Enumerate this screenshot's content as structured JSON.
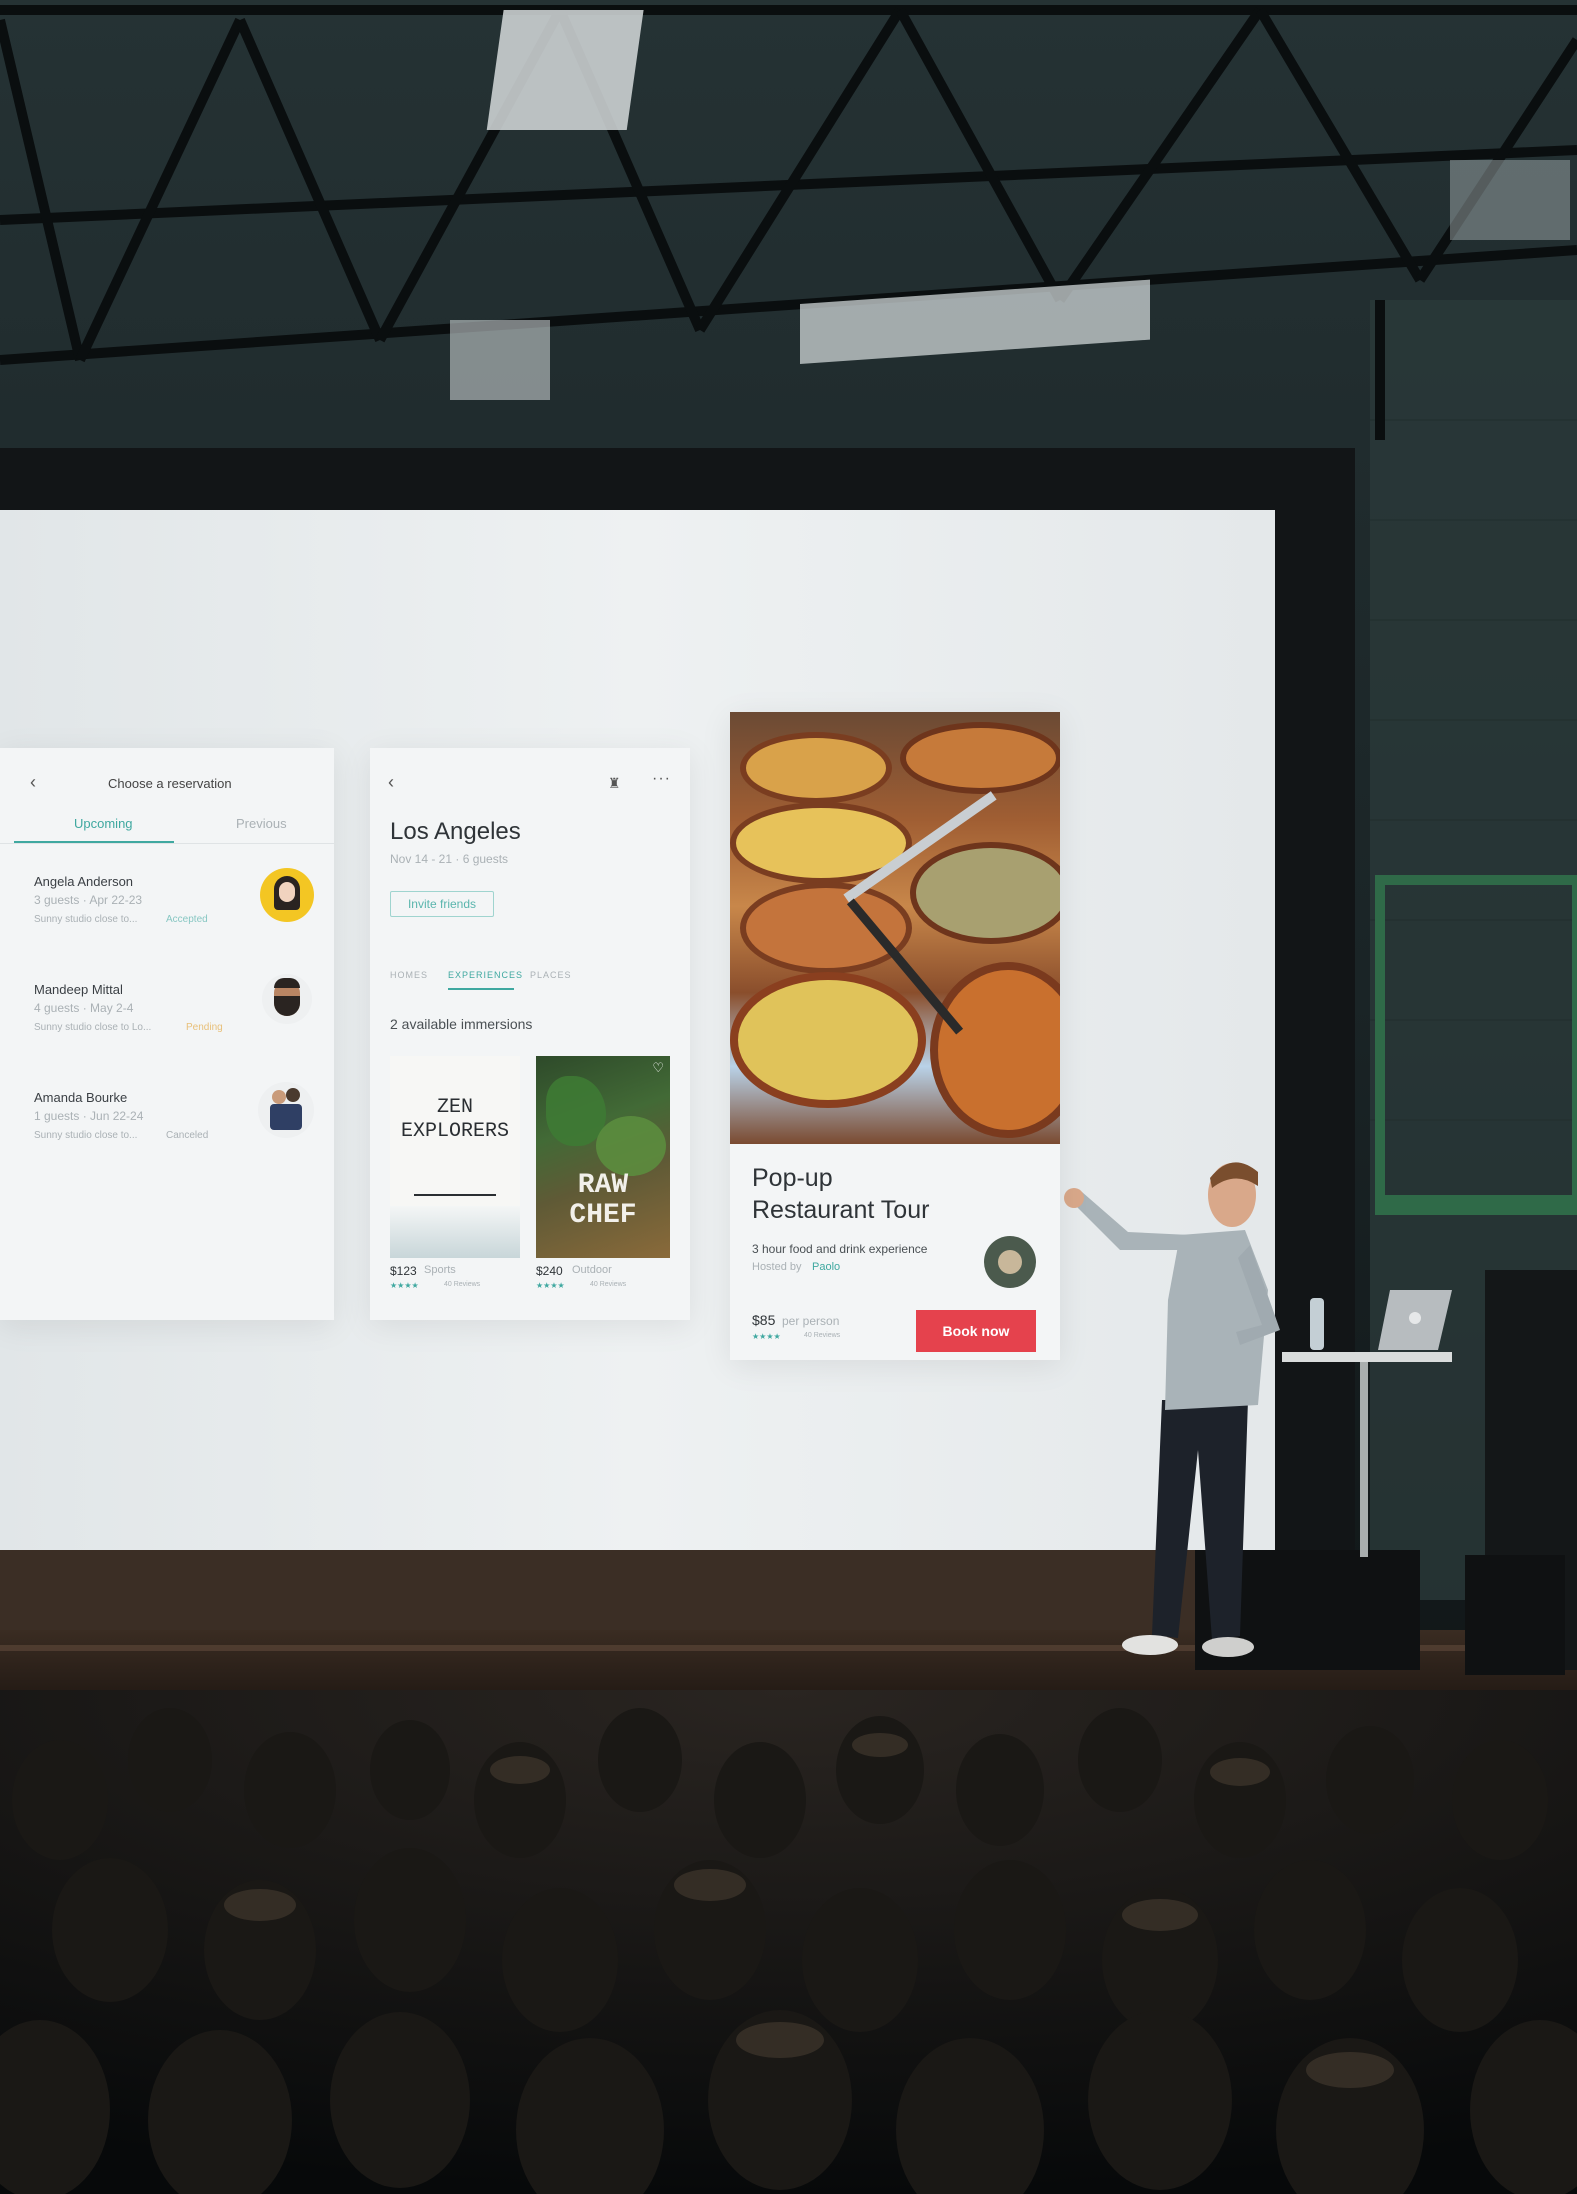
{
  "screen": {
    "left_panel": {
      "back_icon": "chevron-left-icon",
      "title": "Choose a reservation",
      "tabs": [
        "Upcoming",
        "Previous"
      ],
      "items": [
        {
          "name": "Angela Anderson",
          "details": "3 guests · Apr 22-23",
          "desc": "Sunny studio close to...",
          "status": "Accepted"
        },
        {
          "name": "Mandeep Mittal",
          "details": "4 guests · May 2-4",
          "desc": "Sunny studio close to Lo...",
          "status": "Pending"
        },
        {
          "name": "Amanda Bourke",
          "details": "1 guests · Jun 22-24",
          "desc": "Sunny studio close to...",
          "status": "Canceled"
        }
      ]
    },
    "middle_panel": {
      "back_icon": "chevron-left-icon",
      "gift_icon": "gift-icon",
      "more_icon": "more-icon",
      "city": "Los Angeles",
      "dates": "Nov 14 - 21 · 6 guests",
      "invite_label": "Invite friends",
      "tabs": [
        "HOMES",
        "EXPERIENCES",
        "PLACES"
      ],
      "section_title": "2 available immersions",
      "cards": [
        {
          "cover": "ZEN EXPLORERS",
          "price": "$123",
          "category": "Sports",
          "reviews": "40 Reviews",
          "rating": 4
        },
        {
          "cover": "RAW CHEF",
          "price": "$240",
          "category": "Outdoor",
          "reviews": "40 Reviews",
          "rating": 4
        }
      ]
    },
    "right_panel": {
      "title_line1": "Pop-up",
      "title_line2": "Restaurant Tour",
      "description": "3 hour food and drink experience",
      "host_prefix": "Hosted by",
      "host_name": "Paolo",
      "price": "$85",
      "price_suffix": "per person",
      "reviews": "40 Reviews",
      "rating": 4,
      "book_label": "Book now"
    }
  },
  "colors": {
    "accent": "#3fa8a0",
    "book_button": "#e5424d",
    "screen": "#e9ecee",
    "stars": "#3fa8a0"
  }
}
